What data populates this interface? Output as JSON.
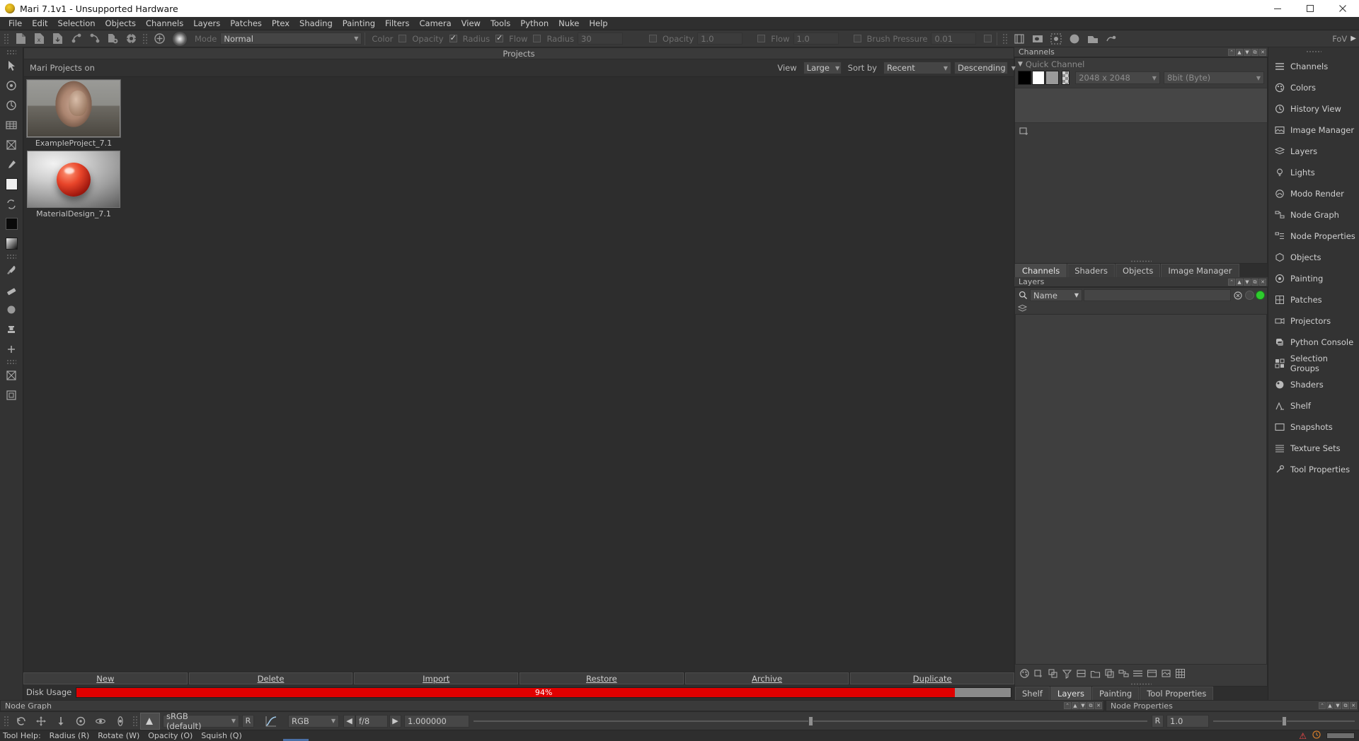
{
  "window": {
    "title": "Mari 7.1v1 - Unsupported Hardware",
    "icon": "mari-logo-icon",
    "minimize": "minimize-icon",
    "maximize": "maximize-icon",
    "close": "close-icon"
  },
  "menubar": {
    "items": [
      {
        "label": "File"
      },
      {
        "label": "Edit"
      },
      {
        "label": "Selection"
      },
      {
        "label": "Objects"
      },
      {
        "label": "Channels"
      },
      {
        "label": "Layers"
      },
      {
        "label": "Patches"
      },
      {
        "label": "Ptex"
      },
      {
        "label": "Shading"
      },
      {
        "label": "Painting"
      },
      {
        "label": "Filters"
      },
      {
        "label": "Camera"
      },
      {
        "label": "View"
      },
      {
        "label": "Tools"
      },
      {
        "label": "Python"
      },
      {
        "label": "Nuke"
      },
      {
        "label": "Help"
      }
    ]
  },
  "toolbar": {
    "mode_label": "Mode",
    "mode_value": "Normal",
    "color_label": "Color",
    "opacity_label_1": "Opacity",
    "radius_label_1": "Radius",
    "flow_label_1": "Flow",
    "radius_label_2": "Radius",
    "radius_value": "30",
    "opacity_label_2": "Opacity",
    "opacity_value": "1.0",
    "flow_label_2": "Flow",
    "flow_value": "1.0",
    "brush_pressure_label": "Brush Pressure",
    "brush_pressure_value": "0.01",
    "fov_label": "FoV",
    "checkbox_color": false,
    "checkbox_opacity_1": false,
    "checkbox_radius_1": true,
    "checkbox_flow_1": true,
    "checkbox_radius_2": false,
    "checkbox_opacity_2": false,
    "checkbox_flow_2": false,
    "checkbox_pressure": false,
    "checkbox_last": false
  },
  "projects": {
    "panel_title": "Projects",
    "header_label": "Mari Projects on",
    "view_label": "View",
    "view_value": "Large",
    "sort_label": "Sort by",
    "sort_value": "Recent",
    "order_value": "Descending",
    "items": [
      {
        "name": "ExampleProject_7.1",
        "thumb": "head-model-thumbnail",
        "selected": true
      },
      {
        "name": "MaterialDesign_7.1",
        "thumb": "red-sphere-thumbnail",
        "selected": false
      }
    ],
    "buttons": [
      {
        "label": "New",
        "mnemonic": "N"
      },
      {
        "label": "Delete",
        "mnemonic": "D"
      },
      {
        "label": "Import",
        "mnemonic": "I"
      },
      {
        "label": "Restore",
        "mnemonic": "R"
      },
      {
        "label": "Archive",
        "mnemonic": "A"
      },
      {
        "label": "Duplicate",
        "mnemonic": "D"
      }
    ],
    "disk_usage_label": "Disk Usage",
    "disk_usage_percent": "94%",
    "disk_usage_value": 94,
    "disk_usage_color": "#e00000"
  },
  "channels_panel": {
    "title": "Channels",
    "quick_channel_label": "Quick Channel",
    "swatches": [
      "black",
      "white",
      "grey",
      "checker"
    ],
    "resolution": "2048 x 2048",
    "depth": "8bit  (Byte)",
    "tabs": [
      {
        "label": "Channels",
        "active": true
      },
      {
        "label": "Shaders",
        "active": false
      },
      {
        "label": "Objects",
        "active": false
      },
      {
        "label": "Image Manager",
        "active": false
      }
    ]
  },
  "layers_panel": {
    "title": "Layers",
    "filter_combo": "Name",
    "search_value": "",
    "tabs": [
      {
        "label": "Shelf",
        "active": false
      },
      {
        "label": "Layers",
        "active": true
      },
      {
        "label": "Painting",
        "active": false
      },
      {
        "label": "Tool Properties",
        "active": false
      }
    ]
  },
  "palette_bar": {
    "items": [
      {
        "label": "Channels",
        "icon": "channels-icon"
      },
      {
        "label": "Colors",
        "icon": "colors-icon"
      },
      {
        "label": "History View",
        "icon": "history-icon"
      },
      {
        "label": "Image Manager",
        "icon": "image-manager-icon"
      },
      {
        "label": "Layers",
        "icon": "layers-icon"
      },
      {
        "label": "Lights",
        "icon": "lights-icon"
      },
      {
        "label": "Modo Render",
        "icon": "modo-render-icon"
      },
      {
        "label": "Node Graph",
        "icon": "node-graph-icon"
      },
      {
        "label": "Node Properties",
        "icon": "node-properties-icon"
      },
      {
        "label": "Objects",
        "icon": "objects-icon"
      },
      {
        "label": "Painting",
        "icon": "painting-icon"
      },
      {
        "label": "Patches",
        "icon": "patches-icon"
      },
      {
        "label": "Projectors",
        "icon": "projectors-icon"
      },
      {
        "label": "Python Console",
        "icon": "python-console-icon"
      },
      {
        "label": "Selection Groups",
        "icon": "selection-groups-icon"
      },
      {
        "label": "Shaders",
        "icon": "shaders-icon"
      },
      {
        "label": "Shelf",
        "icon": "shelf-icon"
      },
      {
        "label": "Snapshots",
        "icon": "snapshots-icon"
      },
      {
        "label": "Texture Sets",
        "icon": "texture-sets-icon"
      },
      {
        "label": "Tool Properties",
        "icon": "tool-properties-icon"
      }
    ]
  },
  "bottom_docks": [
    {
      "title": "Node Graph"
    },
    {
      "title": "Node Properties"
    }
  ],
  "bottom_bar": {
    "colorspace_value": "sRGB (default)",
    "r_button": "R",
    "channel_value": "RGB",
    "stop_value": "f/8",
    "gamma_value": "1.000000",
    "r_label": "R",
    "right_value": "1.0"
  },
  "statusbar": {
    "tool_help_label": "Tool Help:",
    "items": [
      "Radius (R)",
      "Rotate (W)",
      "Opacity (O)",
      "Squish (Q)"
    ],
    "warning_icon": "warning-icon",
    "clock_icon": "clock-icon",
    "progress_icon": "progress-bar-icon"
  }
}
